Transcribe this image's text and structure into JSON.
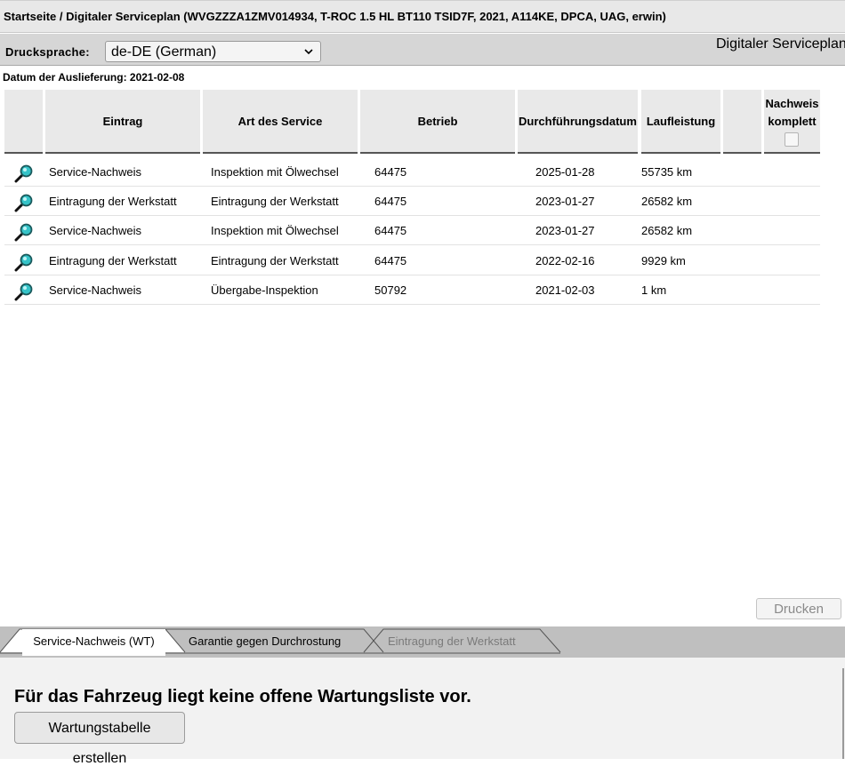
{
  "title": "Startseite / Digitaler Serviceplan (WVGZZZA1ZMV014934, T-ROC 1.5 HL BT110 TSID7F, 2021, A114KE, DPCA, UAG, erwin)",
  "toolbar": {
    "language_label": "Drucksprache:",
    "language_value": "de-DE (German)",
    "right_title": "Digitaler Serviceplan"
  },
  "delivery_date": "Datum der Auslieferung: 2021-02-08",
  "table": {
    "headers": {
      "entry": "Eintrag",
      "service_type": "Art des Service",
      "workshop": "Betrieb",
      "date": "Durchführungsdatum",
      "mileage": "Laufleistung",
      "extra": "",
      "complete_line1": "Nachweis",
      "complete_line2": "komplett"
    },
    "rows": [
      {
        "entry": "Service-Nachweis",
        "service_type": "Inspektion mit Ölwechsel",
        "workshop": "64475",
        "date": "2025-01-28",
        "mileage": "55735 km"
      },
      {
        "entry": "Eintragung der Werkstatt",
        "service_type": "Eintragung der Werkstatt",
        "workshop": "64475",
        "date": "2023-01-27",
        "mileage": "26582 km"
      },
      {
        "entry": "Service-Nachweis",
        "service_type": "Inspektion mit Ölwechsel",
        "workshop": "64475",
        "date": "2023-01-27",
        "mileage": "26582 km"
      },
      {
        "entry": "Eintragung der Werkstatt",
        "service_type": "Eintragung der Werkstatt",
        "workshop": "64475",
        "date": "2022-02-16",
        "mileage": "9929 km"
      },
      {
        "entry": "Service-Nachweis",
        "service_type": "Übergabe-Inspektion",
        "workshop": "50792",
        "date": "2021-02-03",
        "mileage": "1 km"
      }
    ]
  },
  "print_button": "Drucken",
  "tabs": [
    {
      "label": "Service-Nachweis (WT)",
      "state": "active"
    },
    {
      "label": "Garantie gegen Durchrostung",
      "state": "normal"
    },
    {
      "label": "Eintragung der Werkstatt",
      "state": "disabled"
    }
  ],
  "bottom": {
    "message": "Für das Fahrzeug liegt keine offene Wartungsliste vor.",
    "create_button": "Wartungstabelle erstellen"
  },
  "icons": {
    "view": "magnifier-icon",
    "dropdown": "chevron-down-icon",
    "checkbox": "checkbox-unchecked"
  },
  "colors": {
    "title_bg": "#e8e8e8",
    "toolbar_bg": "#d6d6d6",
    "header_bg": "#e9e9e9",
    "tabbar_bg": "#bfbfbf",
    "bottom_bg": "#f2f2f2",
    "magnifier_glass": "#35c3c8"
  }
}
